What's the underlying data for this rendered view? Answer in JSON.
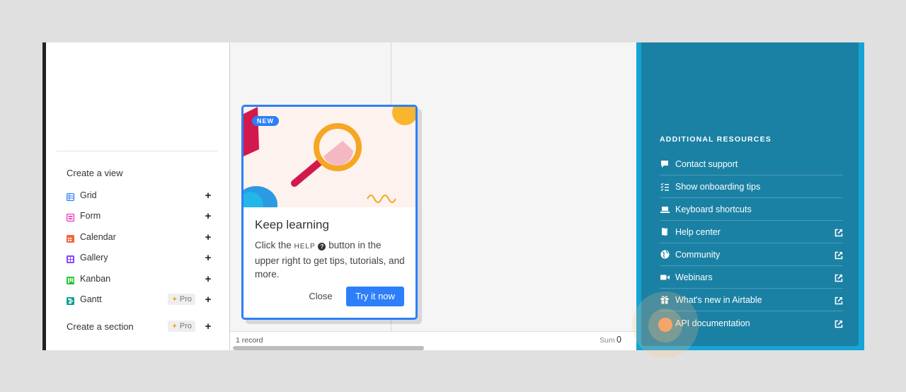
{
  "sidebar": {
    "create_view_heading": "Create a view",
    "views": [
      {
        "label": "Grid",
        "icon": "grid-view-icon",
        "color": "#2d7ff9",
        "pro": false
      },
      {
        "label": "Form",
        "icon": "form-view-icon",
        "color": "#e929ba",
        "pro": false
      },
      {
        "label": "Calendar",
        "icon": "calendar-view-icon",
        "color": "#f7653b",
        "pro": false
      },
      {
        "label": "Gallery",
        "icon": "gallery-view-icon",
        "color": "#8b46ff",
        "pro": false
      },
      {
        "label": "Kanban",
        "icon": "kanban-view-icon",
        "color": "#20c933",
        "pro": false
      },
      {
        "label": "Gantt",
        "icon": "gantt-view-icon",
        "color": "#11a093",
        "pro": true
      }
    ],
    "create_section_label": "Create a section",
    "pro_label": "Pro",
    "plus": "+"
  },
  "grid": {
    "record_count": "1 record",
    "sum_label": "Sum",
    "sum_value": "0"
  },
  "popup": {
    "badge": "NEW",
    "title": "Keep learning",
    "body_before": "Click the",
    "help_word": "HELP",
    "help_icon": "?",
    "body_after": "button in the upper right to get tips, tutorials, and more.",
    "close_label": "Close",
    "try_label": "Try it now"
  },
  "resources": {
    "title": "ADDITIONAL RESOURCES",
    "items": [
      {
        "label": "Contact support",
        "icon": "speech-bubble-icon",
        "external": false
      },
      {
        "label": "Show onboarding tips",
        "icon": "checklist-icon",
        "external": false
      },
      {
        "label": "Keyboard shortcuts",
        "icon": "laptop-icon",
        "external": false
      },
      {
        "label": "Help center",
        "icon": "book-icon",
        "external": true
      },
      {
        "label": "Community",
        "icon": "globe-icon",
        "external": true
      },
      {
        "label": "Webinars",
        "icon": "video-camera-icon",
        "external": true
      },
      {
        "label": "What's new in Airtable",
        "icon": "gift-icon",
        "external": true
      },
      {
        "label": "API documentation",
        "icon": "code-icon",
        "external": true
      }
    ]
  },
  "colors": {
    "accent": "#2d7ff9",
    "panel": "#1a81a4",
    "panel_border": "#16a3d6"
  }
}
